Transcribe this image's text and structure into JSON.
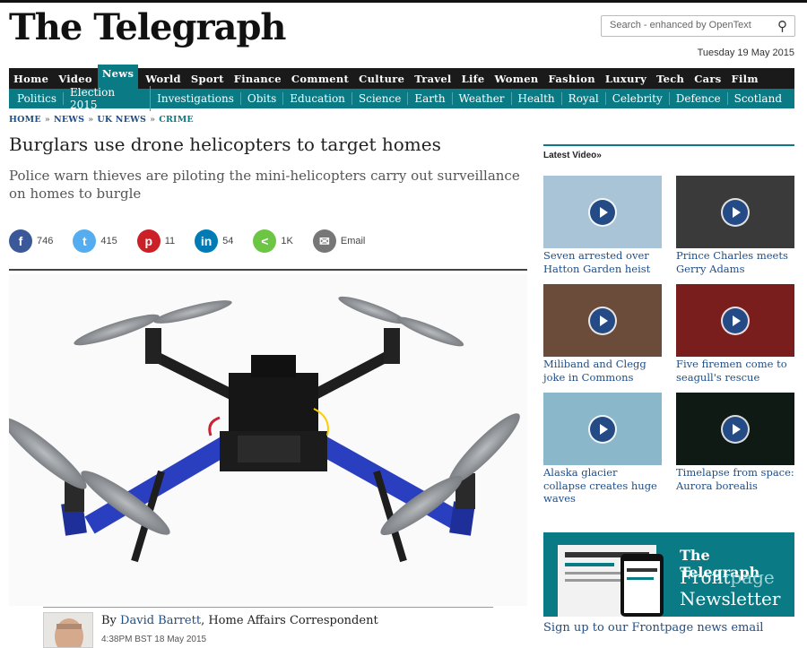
{
  "header": {
    "logo": "The Telegraph",
    "search_placeholder": "Search - enhanced by OpenText",
    "date": "Tuesday 19 May 2015"
  },
  "nav_primary": [
    "Home",
    "Video",
    "News",
    "World",
    "Sport",
    "Finance",
    "Comment",
    "Culture",
    "Travel",
    "Life",
    "Women",
    "Fashion",
    "Luxury",
    "Tech",
    "Cars",
    "Film"
  ],
  "nav_active": "News",
  "nav_secondary": [
    "Politics",
    "Election 2015",
    "Investigations",
    "Obits",
    "Education",
    "Science",
    "Earth",
    "Weather",
    "Health",
    "Royal",
    "Celebrity",
    "Defence",
    "Scotland"
  ],
  "breadcrumb": [
    "HOME",
    "NEWS",
    "UK NEWS",
    "CRIME"
  ],
  "article": {
    "headline": "Burglars use drone helicopters to target homes",
    "standfirst": "Police warn thieves are piloting the mini-helicopters carry out surveillance on homes to burgle",
    "shares": [
      {
        "net": "facebook",
        "glyph": "f",
        "count": "746",
        "color": "#3b5998"
      },
      {
        "net": "twitter",
        "glyph": "t",
        "count": "415",
        "color": "#55acee"
      },
      {
        "net": "pinterest",
        "glyph": "p",
        "count": "11",
        "color": "#cb2027"
      },
      {
        "net": "linkedin",
        "glyph": "in",
        "count": "54",
        "color": "#007bb6"
      },
      {
        "net": "share",
        "glyph": "<",
        "count": "1K",
        "color": "#6cc644"
      },
      {
        "net": "email",
        "glyph": "✉",
        "count": "Email",
        "color": "#777777"
      }
    ],
    "byline_prefix": "By",
    "author": "David Barrett",
    "author_role": ", Home Affairs Correspondent",
    "time": "4:38PM BST 18 May 2015"
  },
  "sidebar": {
    "title": "Latest Video»",
    "videos": [
      {
        "caption": "Seven arrested over Hatton Garden heist",
        "bg": "#a9c4d6"
      },
      {
        "caption": "Prince Charles meets Gerry Adams",
        "bg": "#3a3a3a"
      },
      {
        "caption": "Miliband and Clegg joke in Commons",
        "bg": "#6b4b3a"
      },
      {
        "caption": "Five firemen come to seagull's rescue",
        "bg": "#7a1d1d"
      },
      {
        "caption": "Alaska glacier collapse creates huge waves",
        "bg": "#8ab7c9"
      },
      {
        "caption": "Timelapse from space: Aurora borealis",
        "bg": "#0f1a14"
      }
    ],
    "promo": {
      "brand": "The Telegraph",
      "line1a": "Front",
      "line1b": "page",
      "line2": "Newsletter",
      "link": "Sign up to our Frontpage news email"
    }
  }
}
